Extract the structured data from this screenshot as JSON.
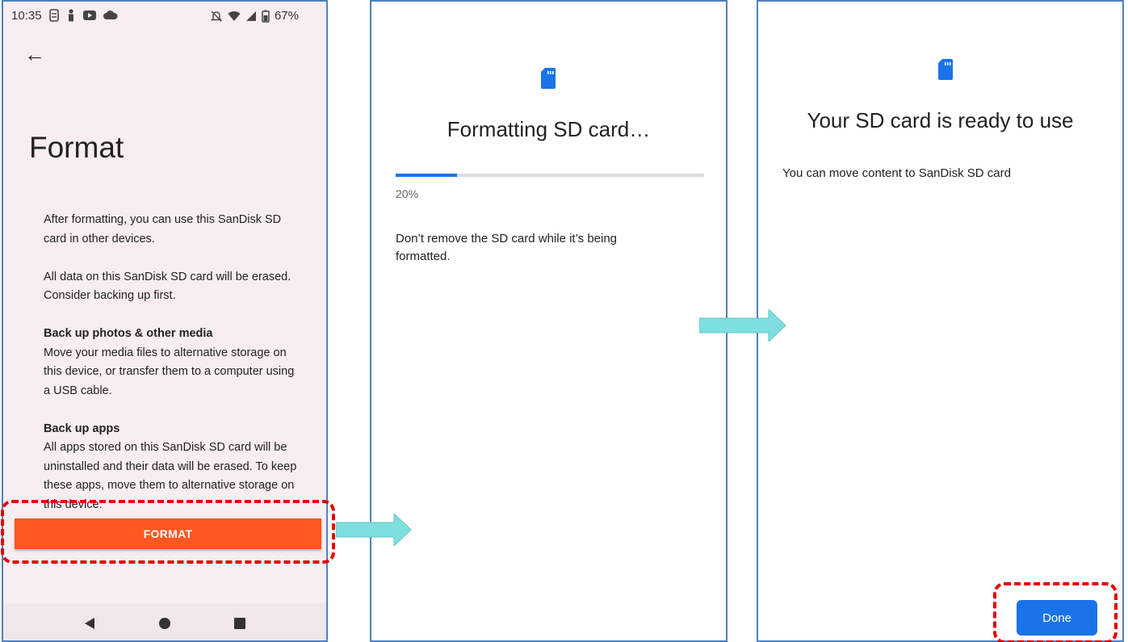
{
  "status_bar": {
    "time": "10:35",
    "battery": "67%"
  },
  "screen1": {
    "title": "Format",
    "para1": "After formatting, you can use this SanDisk SD card in other devices.",
    "para2": "All data on this SanDisk SD card will be erased. Consider backing up first.",
    "section1_heading": "Back up photos & other media",
    "section1_text": "Move your media files to alternative storage on this device, or transfer them to a computer using a USB cable.",
    "section2_heading": "Back up apps",
    "section2_text": "All apps stored on this SanDisk SD card will be uninstalled and their data will be erased. To keep these apps, move them to alternative storage on this device.",
    "format_button": "FORMAT"
  },
  "screen2": {
    "title": "Formatting SD card…",
    "progress_percent": 20,
    "progress_label": "20%",
    "warning": "Don’t remove the SD card while it’s being formatted."
  },
  "screen3": {
    "title": "Your SD card is ready to use",
    "message": "You can move content to SanDisk SD card",
    "done_button": "Done"
  },
  "colors": {
    "format_button": "#ff5722",
    "accent_blue": "#1a73e8",
    "flow_arrow": "#7fdede",
    "highlight": "#e00000",
    "panel_border": "#4f7fbf"
  },
  "icons": [
    "back-arrow-icon",
    "sd-card-icon",
    "nav-back-icon",
    "nav-home-icon",
    "nav-recents-icon",
    "wifi-icon",
    "signal-icon",
    "battery-icon",
    "mute-icon",
    "flow-arrow-icon"
  ]
}
